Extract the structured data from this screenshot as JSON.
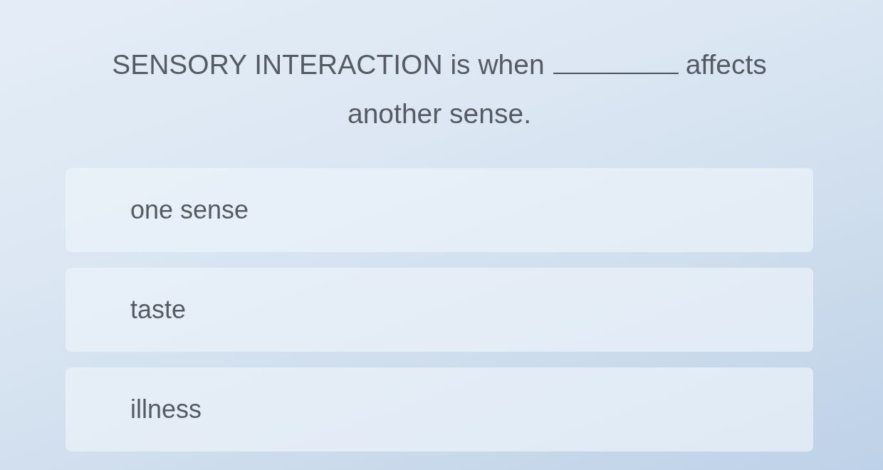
{
  "question": {
    "line_1": {
      "before_blank": "SENSORY INTERACTION is when",
      "after_blank": "affects"
    },
    "line_2": "another sense."
  },
  "options": [
    {
      "label": "one sense",
      "selected": false
    },
    {
      "label": "taste",
      "selected": false
    },
    {
      "label": "illness",
      "selected": false
    }
  ]
}
